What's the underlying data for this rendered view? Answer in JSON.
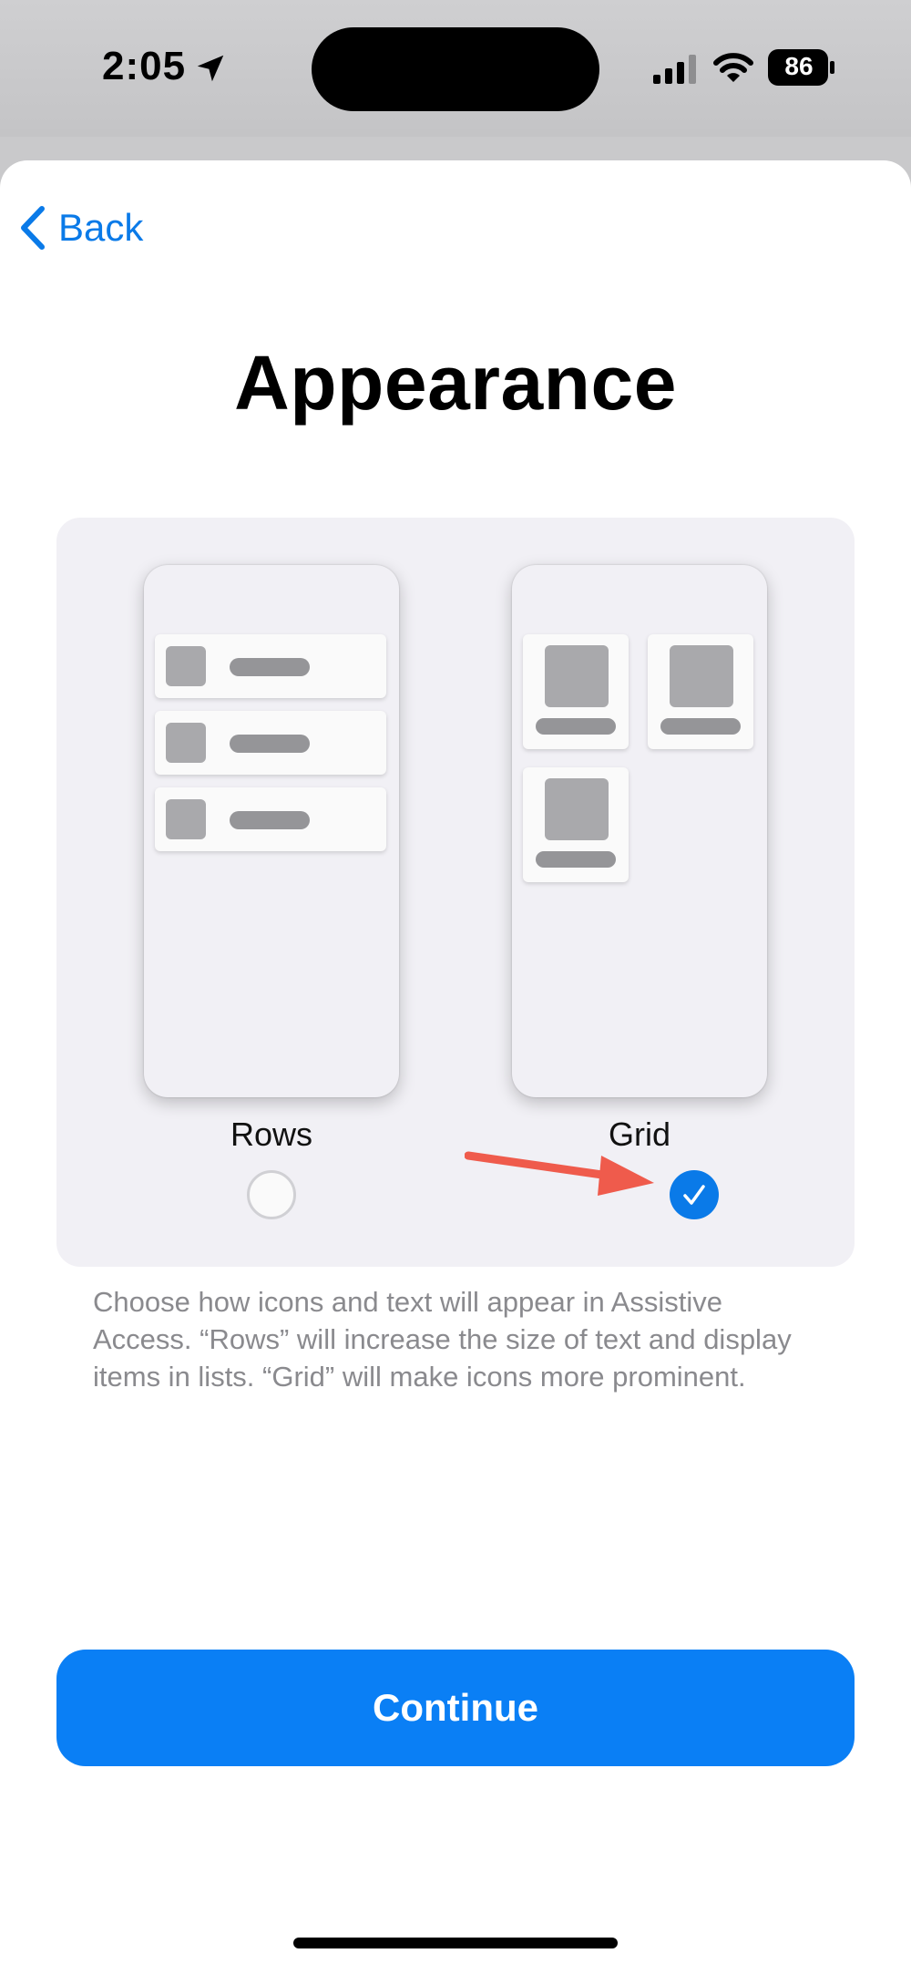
{
  "status_bar": {
    "time": "2:05",
    "battery_level": "86",
    "icons": [
      "location-arrow-icon",
      "cellular-signal-icon",
      "wifi-icon",
      "battery-icon"
    ]
  },
  "nav": {
    "back_label": "Back",
    "back_icon": "chevron-left-icon"
  },
  "page": {
    "title": "Appearance"
  },
  "options": {
    "rows": {
      "label": "Rows",
      "selected": false
    },
    "grid": {
      "label": "Grid",
      "selected": true
    },
    "annotation_color": "#ef5b4c"
  },
  "description": "Choose how icons and text will appear in Assistive Access. “Rows” will increase the size of text and display items in lists. “Grid” will make icons more prominent.",
  "footer": {
    "continue_label": "Continue"
  },
  "colors": {
    "accent": "#0a7ff5",
    "link": "#0a7ae8",
    "secondary_text": "#8a8a8e",
    "card_background": "#f1f0f5"
  }
}
